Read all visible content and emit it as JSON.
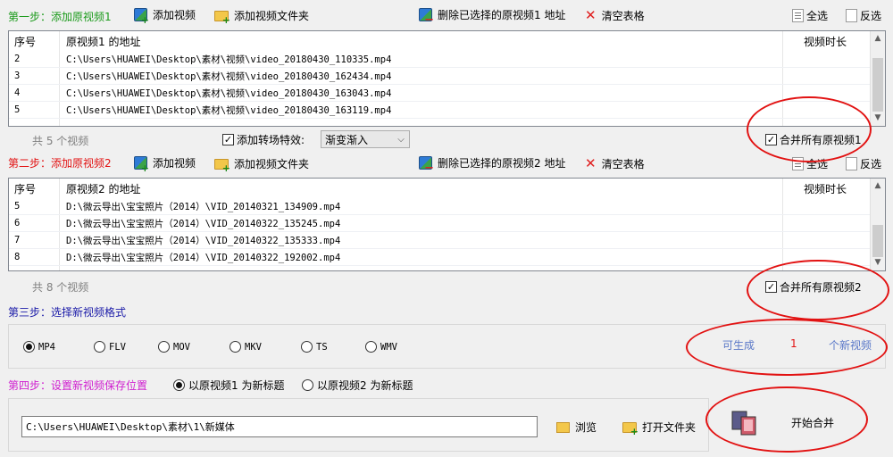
{
  "step1": {
    "title": "第一步：添加原视频1",
    "add_video": "添加视频",
    "add_folder": "添加视频文件夹",
    "delete_selected": "删除已选择的原视频1 地址",
    "clear_table": "清空表格",
    "select_all": "全选",
    "invert": "反选",
    "columns": [
      "序号",
      "原视频1 的地址",
      "视频时长"
    ],
    "rows": [
      {
        "no": "2",
        "path": "C:\\Users\\HUAWEI\\Desktop\\素材\\视频\\video_20180430_110335.mp4"
      },
      {
        "no": "3",
        "path": "C:\\Users\\HUAWEI\\Desktop\\素材\\视频\\video_20180430_162434.mp4"
      },
      {
        "no": "4",
        "path": "C:\\Users\\HUAWEI\\Desktop\\素材\\视频\\video_20180430_163043.mp4"
      },
      {
        "no": "5",
        "path": "C:\\Users\\HUAWEI\\Desktop\\素材\\视频\\video_20180430_163119.mp4"
      }
    ],
    "count": "共 5 个视频",
    "transition_label": "添加转场特效:",
    "transition_value": "渐变渐入",
    "merge_all": "合并所有原视频1"
  },
  "step2": {
    "title": "第二步：添加原视频2",
    "add_video": "添加视频",
    "add_folder": "添加视频文件夹",
    "delete_selected": "删除已选择的原视频2 地址",
    "clear_table": "清空表格",
    "select_all": "全选",
    "invert": "反选",
    "columns": [
      "序号",
      "原视频2 的地址",
      "视频时长"
    ],
    "rows": [
      {
        "no": "5",
        "path": "D:\\微云导出\\宝宝照片（2014）\\VID_20140321_134909.mp4"
      },
      {
        "no": "6",
        "path": "D:\\微云导出\\宝宝照片（2014）\\VID_20140322_135245.mp4"
      },
      {
        "no": "7",
        "path": "D:\\微云导出\\宝宝照片（2014）\\VID_20140322_135333.mp4"
      },
      {
        "no": "8",
        "path": "D:\\微云导出\\宝宝照片（2014）\\VID_20140322_192002.mp4"
      }
    ],
    "count": "共 8 个视频",
    "merge_all": "合并所有原视频2"
  },
  "step3": {
    "title": "第三步：选择新视频格式",
    "formats": [
      "MP4",
      "FLV",
      "MOV",
      "MKV",
      "TS",
      "WMV"
    ],
    "selected": "MP4",
    "can_generate": "可生成",
    "generate_count": "1",
    "new_videos": "个新视频"
  },
  "step4": {
    "title": "第四步：设置新视频保存位置",
    "opt1": "以原视频1 为新标题",
    "opt2": "以原视频2 为新标题",
    "save_path": "C:\\Users\\HUAWEI\\Desktop\\素材\\1\\新媒体",
    "browse": "浏览",
    "open_folder": "打开文件夹",
    "start_merge": "开始合并"
  },
  "colors": {
    "step1_title": "#1a9a1a",
    "step2_title": "#e21212",
    "step3_title": "#1a1aa8",
    "step4_title": "#d020d0",
    "highlight_oval": "#e21212",
    "can_generate": "#5a78c8",
    "count_red": "#e21212"
  },
  "icons": {
    "add_video": "video-add-icon",
    "add_folder": "folder-add-icon",
    "delete": "video-delete-icon",
    "clear": "red-x-icon",
    "select_all": "page-icon",
    "browse": "search-folder-icon",
    "open_folder": "folder-icon",
    "start_merge": "film-merge-icon"
  }
}
